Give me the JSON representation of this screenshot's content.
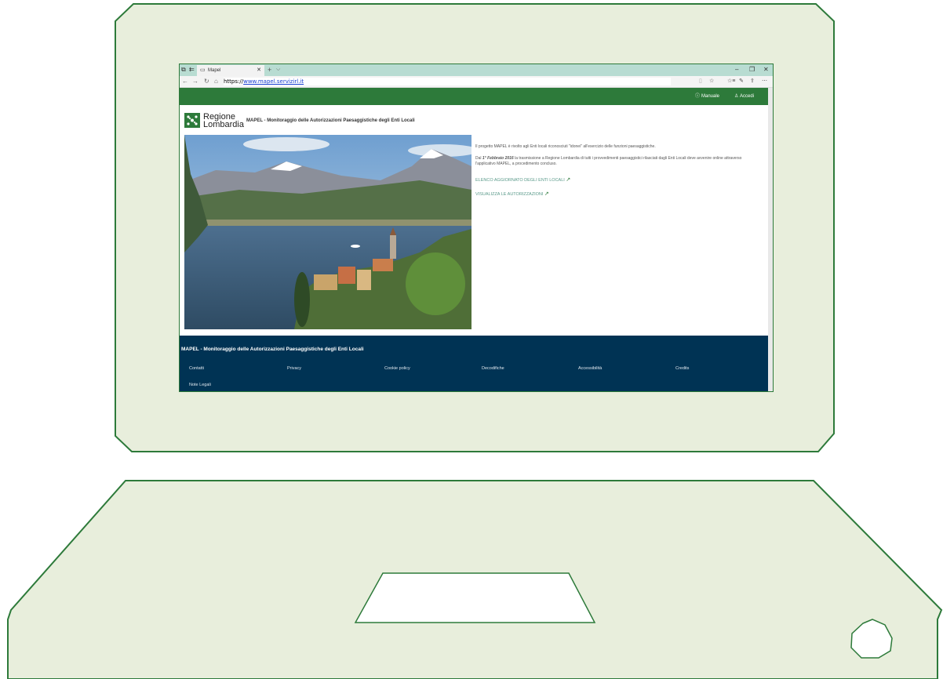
{
  "browser": {
    "tab_title": "Mapel",
    "url_prefix": "https://",
    "url_link": "www.mapel.servizirl.it",
    "icons": [
      "tab-icon",
      "back-icon",
      "forward-icon",
      "refresh-icon",
      "home-icon",
      "star-icon",
      "reading-icon",
      "share-icon",
      "more-icon"
    ]
  },
  "header": {
    "manual": "Manuale",
    "login": "Accedi"
  },
  "site": {
    "logo_line1": "Regione",
    "logo_line2": "Lombardia",
    "title": "MAPEL - Monitoraggio delle Autorizzazioni Paesaggistiche degli Enti Locali"
  },
  "content": {
    "p1": "Il progetto MAPEL è rivolto agli Enti locali riconosciuti \"idonei\" all'esercizio delle funzioni paesaggistiche.",
    "p2_prefix": "Dal ",
    "p2_date": "1° Febbraio 2016",
    "p2_rest": " la trasmissione a Regione Lombardia di tutti i provvedimenti paesaggistici rilasciati dagli Enti Locali deve avvenire online attraverso l'applicativo MAPEL, a procedimento concluso.",
    "link1": "ELENCO AGGIORNATO DEGLI ENTI LOCALI",
    "link2": "VISUALIZZA LE AUTORIZZAZIONI"
  },
  "footer": {
    "title": "MAPEL - Monitoraggio delle Autorizzazioni Paesaggistiche degli Enti Locali",
    "links": [
      "Contatti",
      "Privacy",
      "Cookie policy",
      "Decodifiche",
      "Accessibilità",
      "Credits",
      "Note Legali"
    ]
  },
  "colors": {
    "frame_fill": "#e8eedc",
    "frame_stroke": "#2d7a3a",
    "brand_green": "#2d7a3a",
    "footer_blue": "#003354"
  }
}
